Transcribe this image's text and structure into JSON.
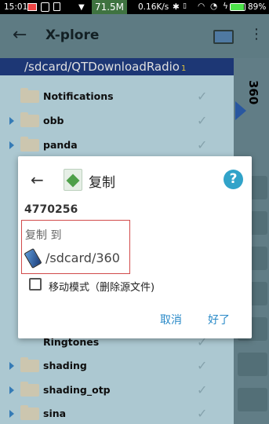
{
  "status_bar": {
    "time": "15:01",
    "net_speed": "71.5M",
    "transfer_rate": "0.16K/s",
    "battery": "89%"
  },
  "app_bar": {
    "title": "X-plore"
  },
  "path_bar": {
    "path": "/sdcard/QTDownloadRadio",
    "count": "1"
  },
  "file_list": {
    "items": [
      {
        "name": "Notifications"
      },
      {
        "name": "obb"
      },
      {
        "name": "panda"
      },
      {
        "name": "Ringtones"
      },
      {
        "name": "shading"
      },
      {
        "name": "shading_otp"
      },
      {
        "name": "sina"
      }
    ]
  },
  "right_pane": {
    "label": "360"
  },
  "dialog": {
    "title": "复制",
    "help": "?",
    "size": "4770256",
    "copy_to_label": "复制 到",
    "destination": "/sdcard/360",
    "move_mode_label": "移动模式（删除源文件)",
    "cancel_label": "取消",
    "ok_label": "好了"
  },
  "colors": {
    "path_bar": "#213f86",
    "accent": "#2a8ac8",
    "highlight_border": "#d14a4a"
  }
}
